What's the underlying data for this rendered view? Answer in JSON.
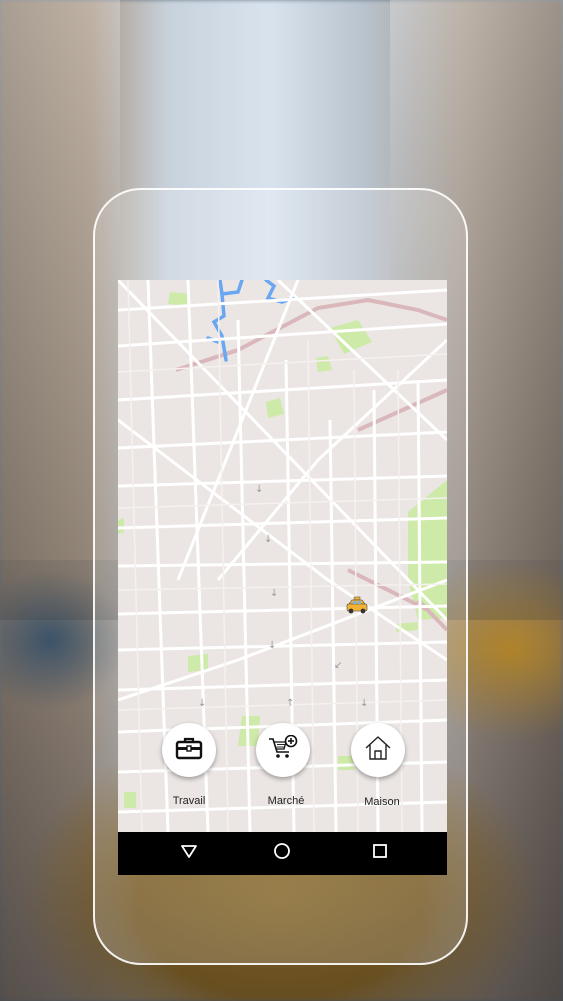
{
  "quick_actions": [
    {
      "label": "Travail",
      "icon": "briefcase-icon"
    },
    {
      "label": "Marché",
      "icon": "cart-plus-icon"
    },
    {
      "label": "Maison",
      "icon": "home-icon"
    }
  ],
  "navbar": {
    "buttons": [
      "back-triangle",
      "home-circle",
      "recents-square"
    ]
  },
  "map": {
    "marker": "taxi-icon",
    "colors": {
      "land": "#ebe6e4",
      "road": "#ffffff",
      "park": "#cdeaa8",
      "water": "#6aa7f2",
      "rail": "#d9b7bb"
    }
  },
  "colors": {
    "navbar_bg": "#000000",
    "button_bg": "#ffffff",
    "frame": "#ffffff"
  }
}
